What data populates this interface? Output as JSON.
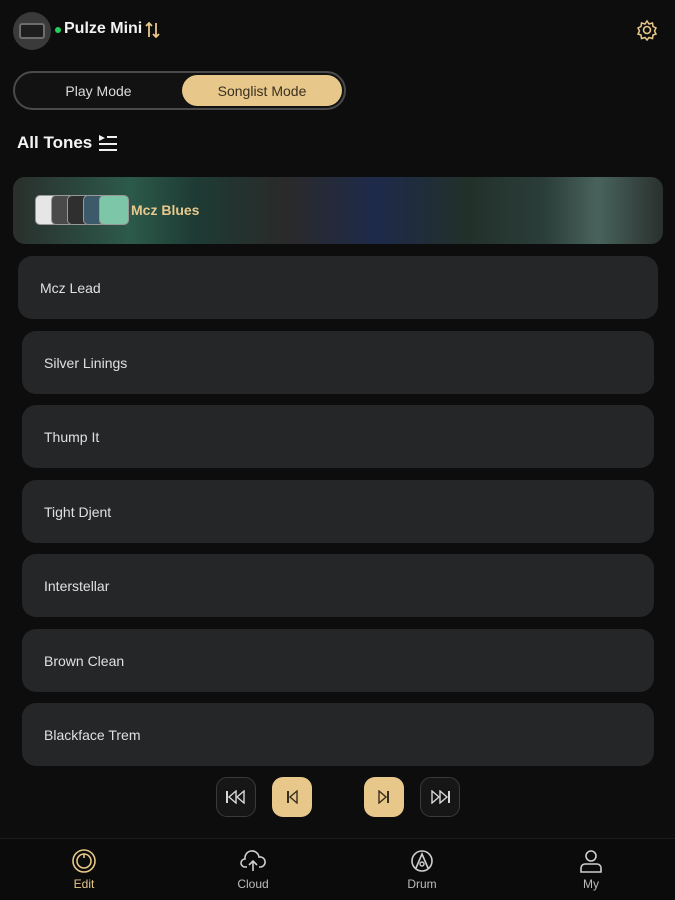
{
  "header": {
    "device_name": "Pulze Mini",
    "connected_color": "#1fd05a"
  },
  "mode_toggle": {
    "play_label": "Play Mode",
    "songlist_label": "Songlist Mode",
    "selected": "Songlist Mode"
  },
  "section": {
    "title": "All Tones"
  },
  "active_tone": {
    "name": "Mcz Blues"
  },
  "tones": [
    {
      "name": "Mcz Lead"
    },
    {
      "name": "Silver Linings"
    },
    {
      "name": "Thump It"
    },
    {
      "name": "Tight Djent"
    },
    {
      "name": "Interstellar"
    },
    {
      "name": "Brown Clean"
    },
    {
      "name": "Blackface Trem"
    }
  ],
  "transport": {
    "buttons": [
      "skip-to-start-icon",
      "previous-icon",
      "next-icon",
      "skip-to-end-icon"
    ]
  },
  "nav": {
    "items": [
      {
        "label": "Edit",
        "icon": "edit-knob-icon",
        "active": true
      },
      {
        "label": "Cloud",
        "icon": "cloud-icon",
        "active": false
      },
      {
        "label": "Drum",
        "icon": "drum-icon",
        "active": false
      },
      {
        "label": "My",
        "icon": "user-icon",
        "active": false
      }
    ]
  },
  "colors": {
    "accent": "#e8c88a",
    "background": "#0d0d0d",
    "row": "#252627"
  }
}
